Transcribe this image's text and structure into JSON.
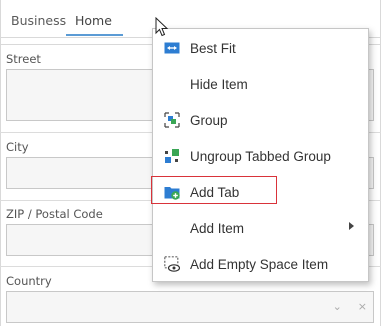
{
  "tabs": {
    "business": "Business",
    "home": "Home"
  },
  "fields": {
    "street": "Street",
    "city": "City",
    "zip": "ZIP / Postal Code",
    "country": "Country"
  },
  "country_combo": {
    "dropdown_glyph": "⌄",
    "clear_glyph": "×"
  },
  "menu": {
    "items": [
      {
        "label": "Best Fit",
        "icon": "best-fit-icon"
      },
      {
        "label": "Hide Item",
        "icon": ""
      },
      {
        "label": "Group",
        "icon": "group-icon"
      },
      {
        "label": "Ungroup Tabbed Group",
        "icon": "ungroup-icon"
      },
      {
        "label": "Add Tab",
        "icon": "add-tab-icon"
      },
      {
        "label": "Add Item",
        "icon": ""
      },
      {
        "label": "Add Empty Space Item",
        "icon": "empty-space-icon"
      }
    ]
  },
  "colors": {
    "accent": "#5b9bd5",
    "highlight": "#d9333a",
    "icon_blue": "#2d7dd2",
    "icon_green": "#3aa655"
  }
}
